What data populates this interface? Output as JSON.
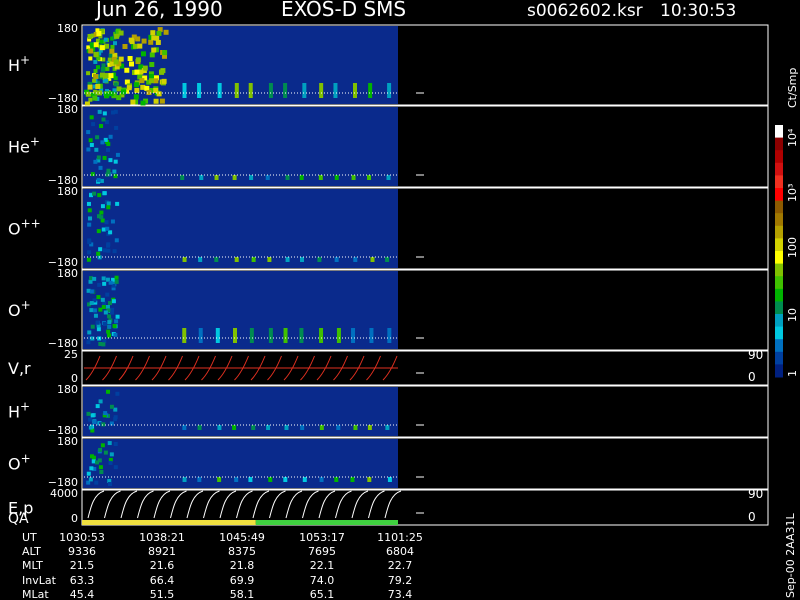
{
  "header": {
    "date": "Jun 26, 1990",
    "instrument": "EXOS-D SMS",
    "file": "s0062602.ksr",
    "time": "10:30:53"
  },
  "colors": {
    "background": "#000000",
    "panel_fill": "#0a2a8c",
    "velocity_trace": "#e03020",
    "energy_trace": "#ffffff",
    "qa_good": "#40d040",
    "qa_caution": "#f0e040"
  },
  "chart_data": {
    "type": "heatmap",
    "panels": [
      {
        "label": "H+",
        "ymax": "180",
        "ymin": "−180"
      },
      {
        "label": "He+",
        "ymax": "180",
        "ymin": "−180"
      },
      {
        "label": "O++",
        "ymax": "180",
        "ymin": "−180"
      },
      {
        "label": "O+",
        "ymax": "180",
        "ymin": "−180"
      },
      {
        "label": "V,r",
        "ymax": "25",
        "ymin": "0",
        "right_top": "90",
        "right_bottom": "0"
      },
      {
        "label": "H+",
        "ymax": "180",
        "ymin": "−180"
      },
      {
        "label": "O+",
        "ymax": "180",
        "ymin": "−180"
      },
      {
        "label": "E,p",
        "label2": "QA",
        "ymax": "4000",
        "ymin": "0",
        "right_top": "90",
        "right_bottom": "0"
      }
    ],
    "colorbar": {
      "unit": "Ct/Smp",
      "ticks": [
        "10⁴",
        "10³",
        "100",
        "10",
        "1"
      ],
      "colors": [
        "#ffffff",
        "#8c0000",
        "#b00000",
        "#d01010",
        "#f03020",
        "#ff0000",
        "#8c5a00",
        "#a07800",
        "#b4a000",
        "#d2d200",
        "#ffff00",
        "#80c000",
        "#40c000",
        "#00b400",
        "#008c50",
        "#00a0c0",
        "#00c8e0",
        "#0070c0",
        "#0040a0",
        "#002080"
      ]
    },
    "qa_bar": [
      {
        "from": 0.0,
        "to": 0.55,
        "level": "caution"
      },
      {
        "from": 0.55,
        "to": 1.0,
        "level": "good"
      }
    ],
    "orbit_table": {
      "rows": [
        {
          "label": "UT",
          "values": [
            "1030:53",
            "1038:21",
            "1045:49",
            "1053:17",
            "1101:25"
          ]
        },
        {
          "label": "ALT",
          "values": [
            "9336",
            "8921",
            "8375",
            "7695",
            "6804"
          ]
        },
        {
          "label": "MLT",
          "values": [
            "21.5",
            "21.6",
            "21.8",
            "22.1",
            "22.7"
          ]
        },
        {
          "label": "InvLat",
          "values": [
            "63.3",
            "66.4",
            "69.9",
            "74.0",
            "79.2"
          ]
        },
        {
          "label": "MLat",
          "values": [
            "45.4",
            "51.5",
            "58.1",
            "65.1",
            "73.4"
          ]
        }
      ]
    },
    "footer_id": "Sep-00  2AA31L"
  }
}
